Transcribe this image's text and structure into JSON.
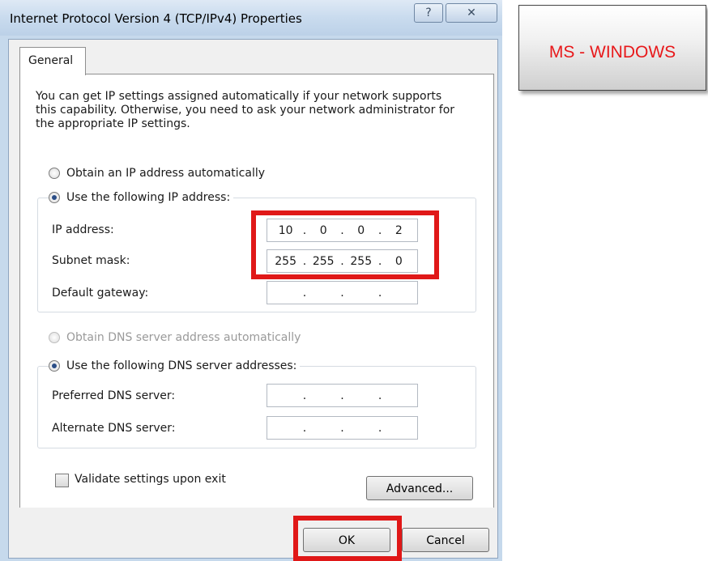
{
  "window": {
    "title": "Internet Protocol Version 4 (TCP/IPv4) Properties",
    "help_label": "?",
    "close_label": "✕"
  },
  "tabs": [
    {
      "label": "General",
      "active": true
    }
  ],
  "intro_text": "You can get IP settings assigned automatically if your network supports this capability. Otherwise, you need to ask your network administrator for the appropriate IP settings.",
  "ip_section": {
    "auto_label": "Obtain an IP address automatically",
    "manual_label": "Use the following IP address:",
    "selected": "manual",
    "fields": [
      {
        "label": "IP address:",
        "octets": [
          "10",
          "0",
          "0",
          "2"
        ]
      },
      {
        "label": "Subnet mask:",
        "octets": [
          "255",
          "255",
          "255",
          "0"
        ]
      },
      {
        "label": "Default gateway:",
        "octets": [
          "",
          "",
          "",
          ""
        ]
      }
    ]
  },
  "dns_section": {
    "auto_label": "Obtain DNS server address automatically",
    "manual_label": "Use the following DNS server addresses:",
    "selected": "manual",
    "fields": [
      {
        "label": "Preferred DNS server:",
        "octets": [
          "",
          "",
          "",
          ""
        ]
      },
      {
        "label": "Alternate DNS server:",
        "octets": [
          "",
          "",
          "",
          ""
        ]
      }
    ]
  },
  "validate_label": "Validate settings upon exit",
  "validate_checked": false,
  "buttons": {
    "advanced": "Advanced...",
    "ok": "OK",
    "cancel": "Cancel"
  },
  "annotation": {
    "label": "MS - WINDOWS",
    "highlight_color": "#e01818"
  }
}
